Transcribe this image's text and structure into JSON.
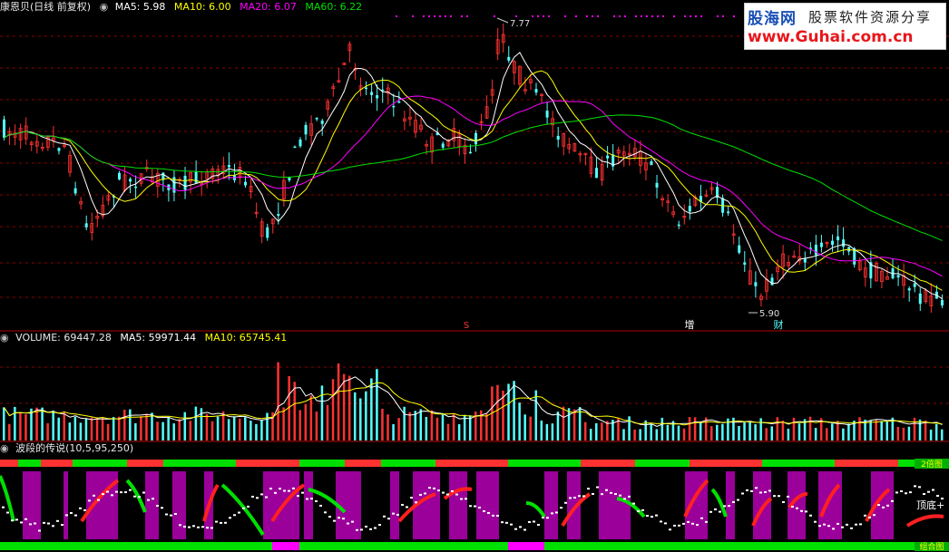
{
  "main_header": {
    "title": "康恩贝(日线 前复权)",
    "ma5": "MA5: 5.98",
    "ma10": "MA10: 6.00",
    "ma20": "MA20: 6.07",
    "ma60": "MA60: 6.22"
  },
  "volume_header": {
    "title": "VOLUME: 69447.28",
    "ma5": "MA5: 59971.44",
    "ma10": "MA10: 65745.41"
  },
  "indicator_header": {
    "title": "波段的传说(10,5,95,250)"
  },
  "logo": {
    "line1a": "股海网",
    "line1b": "股票软件资源分享",
    "line2": "www.Guhai.com.cn"
  },
  "annotations": {
    "high_label": "7.77",
    "low_label": "5.90",
    "s_mark": "S",
    "zeng_mark": "增",
    "cai_mark": "财",
    "dingdi_label": "顶底+",
    "right_tag_top": "2倍图",
    "right_tag_bottom": "组合图"
  },
  "colors": {
    "up": "#ff3232",
    "down": "#54ffff",
    "ma5": "#ffffff",
    "ma10": "#ffff00",
    "ma20": "#ff00ff",
    "ma60": "#00e000",
    "band": "#9b009b",
    "grid": "#8b0000"
  },
  "chart_data": [
    {
      "type": "candlestick",
      "title": "康恩贝(日线 前复权)",
      "series": [
        {
          "name": "MA5",
          "last": 5.98
        },
        {
          "name": "MA10",
          "last": 6.0
        },
        {
          "name": "MA20",
          "last": 6.07
        },
        {
          "name": "MA60",
          "last": 6.22
        }
      ],
      "highest": 7.77,
      "lowest": 5.9,
      "ylim": [
        5.6,
        7.9
      ]
    },
    {
      "type": "bar",
      "title": "VOLUME",
      "series": [
        {
          "name": "VOLUME",
          "last": 69447.28
        },
        {
          "name": "MA5",
          "last": 59971.44
        },
        {
          "name": "MA10",
          "last": 65745.41
        }
      ]
    },
    {
      "type": "line",
      "title": "波段的传说(10,5,95,250)"
    }
  ]
}
